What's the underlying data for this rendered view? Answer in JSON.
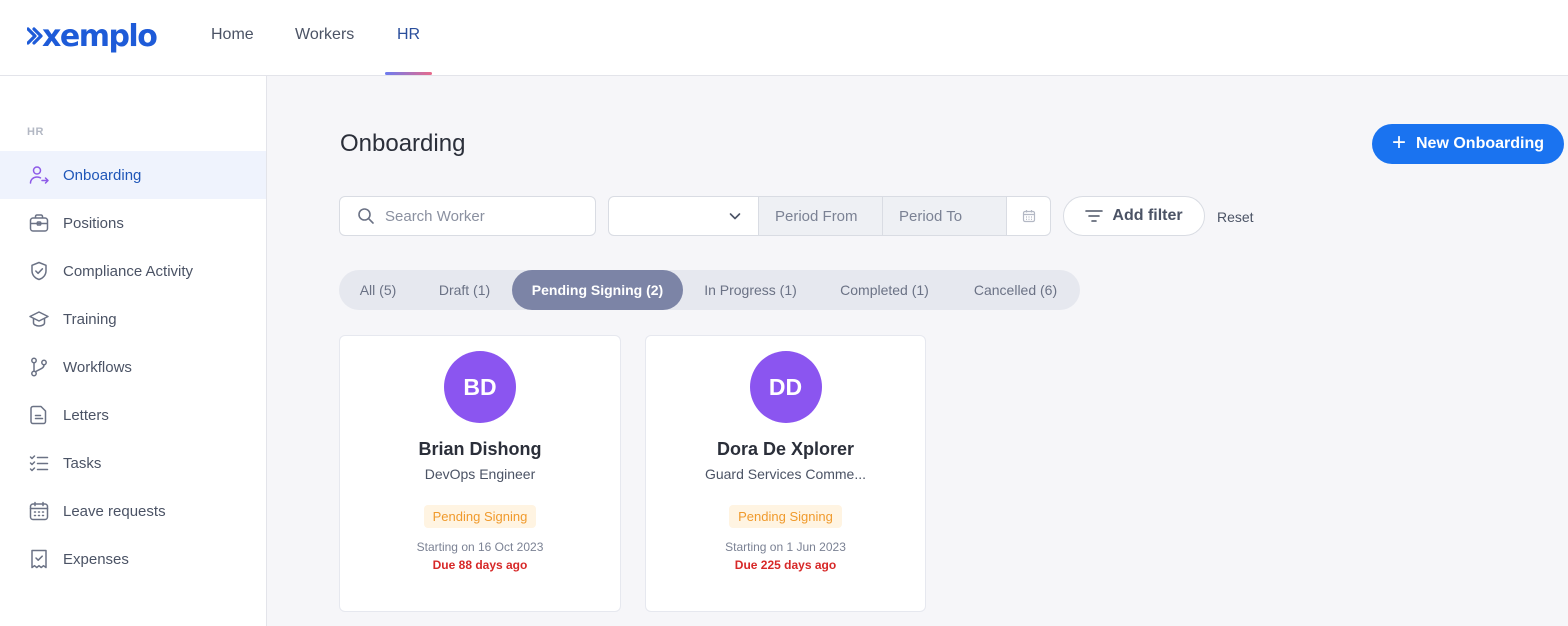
{
  "app": {
    "logo_text": "xemplo",
    "brand_color": "#1e5bd8"
  },
  "topnav": {
    "items": [
      {
        "label": "Home"
      },
      {
        "label": "Workers"
      },
      {
        "label": "HR",
        "active": true
      }
    ]
  },
  "sidebar": {
    "section": "HR",
    "items": [
      {
        "label": "Onboarding",
        "icon": "user-arrow-icon",
        "active": true
      },
      {
        "label": "Positions",
        "icon": "briefcase-icon"
      },
      {
        "label": "Compliance Activity",
        "icon": "shield-check-icon"
      },
      {
        "label": "Training",
        "icon": "graduation-cap-icon"
      },
      {
        "label": "Workflows",
        "icon": "branch-icon"
      },
      {
        "label": "Letters",
        "icon": "document-icon"
      },
      {
        "label": "Tasks",
        "icon": "checklist-icon"
      },
      {
        "label": "Leave requests",
        "icon": "calendar-icon"
      },
      {
        "label": "Expenses",
        "icon": "receipt-icon"
      }
    ]
  },
  "main": {
    "title": "Onboarding",
    "new_button_label": "New Onboarding",
    "search_placeholder": "Search Worker",
    "period_select_value": "",
    "period_from_placeholder": "Period From",
    "period_to_placeholder": "Period To",
    "add_filter_label": "Add filter",
    "reset_label": "Reset",
    "tabs": [
      {
        "label": "All (5)"
      },
      {
        "label": "Draft (1)"
      },
      {
        "label": "Pending Signing (2)",
        "active": true
      },
      {
        "label": "In Progress (1)"
      },
      {
        "label": "Completed (1)"
      },
      {
        "label": "Cancelled (6)"
      }
    ],
    "cards": [
      {
        "initials": "BD",
        "name": "Brian Dishong",
        "role": "DevOps Engineer",
        "status": "Pending Signing",
        "starting": "Starting on 16 Oct 2023",
        "due": "Due 88 days ago"
      },
      {
        "initials": "DD",
        "name": "Dora De Xplorer",
        "role": "Guard Services Comme...",
        "status": "Pending Signing",
        "starting": "Starting on 1 Jun 2023",
        "due": "Due 225 days ago"
      }
    ]
  },
  "colors": {
    "primary_button": "#1a73f0",
    "avatar": "#8b55f0",
    "active_tab": "#7c84a6",
    "status_badge_bg": "#fff4e2",
    "status_badge_text": "#f09a2c",
    "due_text": "#d72828"
  }
}
